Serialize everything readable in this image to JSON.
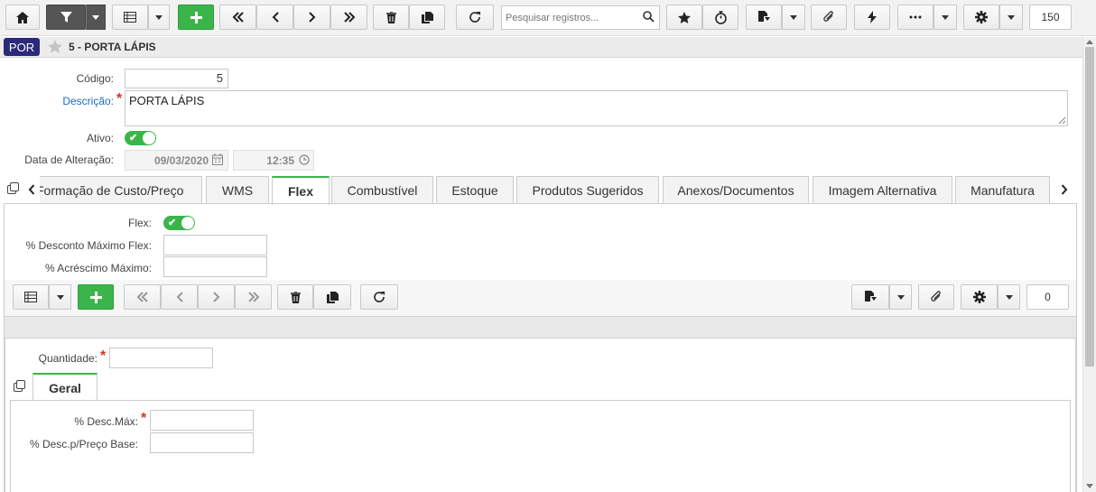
{
  "toolbar": {
    "search_placeholder": "Pesquisar registros...",
    "record_count": "150"
  },
  "header": {
    "badge": "POR",
    "title": "5 - PORTA LÁPIS"
  },
  "form": {
    "codigo_label": "Código:",
    "codigo_value": "5",
    "descricao_label": "Descrição:",
    "descricao_value": "PORTA LÁPIS",
    "ativo_label": "Ativo:",
    "data_label": "Data de Alteração:",
    "data_value": "09/03/2020",
    "hora_value": "12:35"
  },
  "tabs": [
    {
      "label": "Formação de Custo/Preço"
    },
    {
      "label": "WMS"
    },
    {
      "label": "Flex"
    },
    {
      "label": "Combustível"
    },
    {
      "label": "Estoque"
    },
    {
      "label": "Produtos Sugeridos"
    },
    {
      "label": "Anexos/Documentos"
    },
    {
      "label": "Imagem Alternativa"
    },
    {
      "label": "Manufatura"
    }
  ],
  "flex": {
    "flex_label": "Flex:",
    "desc_max_label": "% Desconto Máximo Flex:",
    "acresc_label": "% Acréscimo Máximo:",
    "sub_count": "0",
    "quantidade_label": "Quantidade:",
    "geral_tab": "Geral",
    "desc_max_item_label": "% Desc.Máx:",
    "desc_preco_label": "% Desc.p/Preço Base:"
  },
  "colors": {
    "accent_green": "#3bb54a",
    "link_blue": "#1a6bc5",
    "badge_bg": "#2b2a7a"
  }
}
